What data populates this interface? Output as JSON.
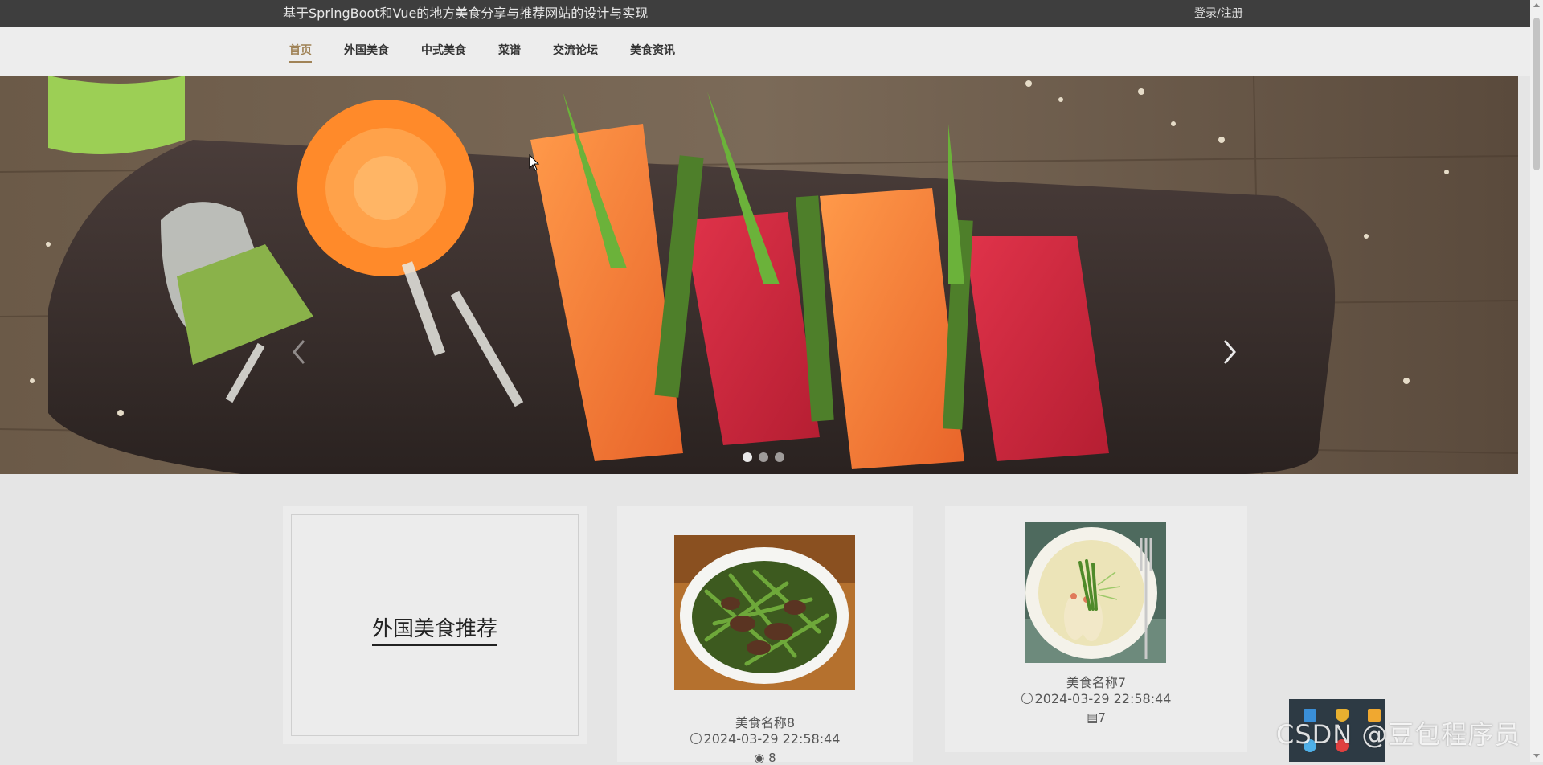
{
  "header": {
    "site_title": "基于SpringBoot和Vue的地方美食分享与推荐网站的设计与实现",
    "login_label": "登录/注册"
  },
  "nav": {
    "items": [
      {
        "label": "首页",
        "active": true
      },
      {
        "label": "外国美食",
        "active": false
      },
      {
        "label": "中式美食",
        "active": false
      },
      {
        "label": "菜谱",
        "active": false
      },
      {
        "label": "交流论坛",
        "active": false
      },
      {
        "label": "美食资讯",
        "active": false
      }
    ],
    "accent_color": "#a08357"
  },
  "carousel": {
    "slide_count": 3,
    "active_index": 0,
    "icons": {
      "prev": "chevron-left-icon",
      "next": "chevron-right-icon"
    }
  },
  "section": {
    "title": "外国美食推荐"
  },
  "foods": [
    {
      "name": "美食名称8",
      "date": "2024-03-29 22:58:44",
      "views": "8"
    },
    {
      "name": "美食名称7",
      "date": "2024-03-29 22:58:44",
      "views": "7"
    }
  ],
  "watermark": "CSDN @豆包程序员"
}
